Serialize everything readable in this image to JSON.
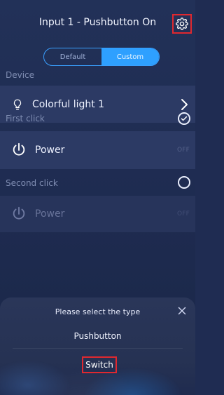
{
  "header": {
    "title": "Input 1 - Pushbutton On"
  },
  "mode_tabs": {
    "default_label": "Default",
    "custom_label": "Custom",
    "selected": "Custom"
  },
  "sections": {
    "device_label": "Device",
    "first_click_label": "First click",
    "second_click_label": "Second click"
  },
  "device": {
    "name": "Colorful light 1",
    "icon": "bulb-icon"
  },
  "first_click": {
    "action_label": "Power",
    "state": "OFF",
    "selected": true
  },
  "second_click": {
    "action_label": "Power",
    "state": "OFF",
    "selected": false
  },
  "sheet": {
    "title": "Please select the type",
    "options": [
      "Pushbutton",
      "Switch"
    ],
    "highlighted_option": "Switch"
  },
  "colors": {
    "background": "#1f2c52",
    "row": "#2c3a64",
    "accent": "#2ea0ff",
    "highlight": "#e0282f"
  }
}
